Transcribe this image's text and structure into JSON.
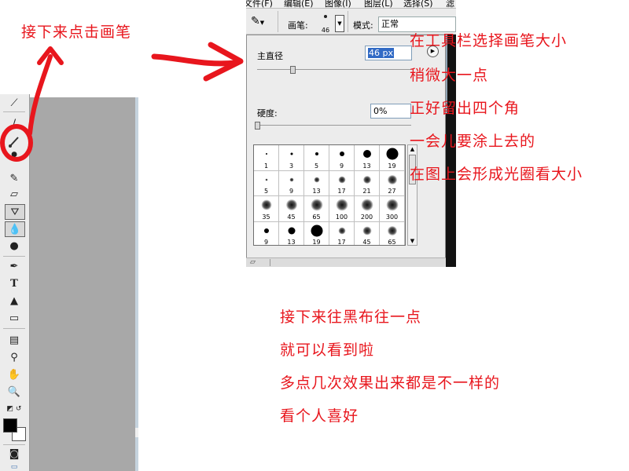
{
  "annotations": {
    "top_left": "接下来点击画笔",
    "right_block": [
      "在工具栏选择画笔大小",
      "稍微大一点",
      "正好留出四个角",
      "一会儿要涂上去的",
      "在图上会形成光圈看大小"
    ],
    "bottom_block": [
      "接下来往黑布往一点",
      "就可以看到啦",
      "多点几次效果出来都是不一样的",
      "看个人喜好"
    ]
  },
  "menubar": {
    "items": [
      "文件(F)",
      "编辑(E)",
      "图像(I)",
      "图层(L)",
      "选择(S)",
      "滤"
    ]
  },
  "options_bar": {
    "brush_label": "画笔:",
    "brush_size": "46",
    "mode_label": "模式:",
    "mode_value": "正常"
  },
  "brush_panel": {
    "master_diameter_label": "主直径",
    "master_diameter_value": "46 px",
    "hardness_label": "硬度:",
    "hardness_value": "0%",
    "master_diameter_slider": 0.18,
    "hardness_slider": 0.0,
    "presets": [
      {
        "label": "1",
        "size": 2,
        "soft": false
      },
      {
        "label": "3",
        "size": 3,
        "soft": false
      },
      {
        "label": "5",
        "size": 4,
        "soft": false
      },
      {
        "label": "9",
        "size": 6,
        "soft": false
      },
      {
        "label": "13",
        "size": 10,
        "soft": false
      },
      {
        "label": "19",
        "size": 15,
        "soft": false
      },
      {
        "label": "5",
        "size": 3,
        "soft": true
      },
      {
        "label": "9",
        "size": 5,
        "soft": true
      },
      {
        "label": "13",
        "size": 7,
        "soft": true
      },
      {
        "label": "17",
        "size": 9,
        "soft": true
      },
      {
        "label": "21",
        "size": 10,
        "soft": true
      },
      {
        "label": "27",
        "size": 12,
        "soft": true
      },
      {
        "label": "35",
        "size": 13,
        "soft": true
      },
      {
        "label": "45",
        "size": 14,
        "soft": true
      },
      {
        "label": "65",
        "size": 15,
        "soft": true
      },
      {
        "label": "100",
        "size": 15,
        "soft": true
      },
      {
        "label": "200",
        "size": 15,
        "soft": true
      },
      {
        "label": "300",
        "size": 15,
        "soft": true
      },
      {
        "label": "9",
        "size": 6,
        "soft": false
      },
      {
        "label": "13",
        "size": 9,
        "soft": false
      },
      {
        "label": "19",
        "size": 15,
        "soft": false
      },
      {
        "label": "17",
        "size": 9,
        "soft": true
      },
      {
        "label": "45",
        "size": 11,
        "soft": true
      },
      {
        "label": "65",
        "size": 12,
        "soft": true
      }
    ]
  },
  "toolbox": {
    "tools": [
      "healing-brush",
      "history-brush",
      "brush",
      "clone-stamp",
      "art-history-brush",
      "eraser",
      "paint-bucket",
      "blur",
      "dodge",
      "pen",
      "type",
      "path-select",
      "rectangle",
      "notes",
      "eyedropper",
      "hand",
      "zoom"
    ],
    "foreground_color": "#000000",
    "background_color": "#ffffff"
  },
  "colors": {
    "annotation": "#e8161d",
    "toolbox_bg": "#ececec",
    "canvas_gray": "#a8a8a8"
  }
}
